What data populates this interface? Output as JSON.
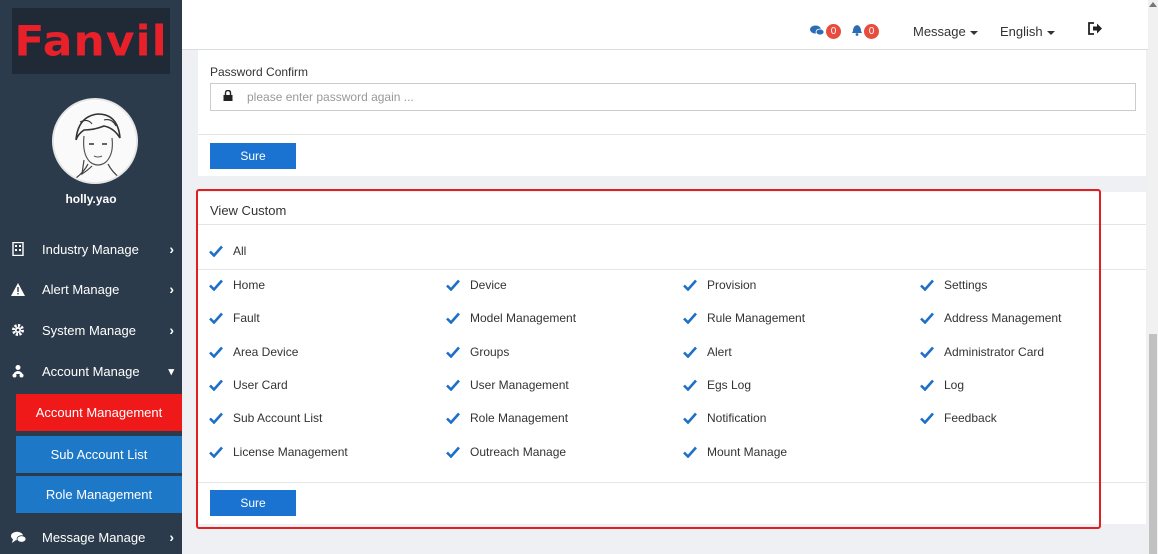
{
  "app": {
    "logo_text": "Fanvil"
  },
  "user": {
    "name": "holly.yao"
  },
  "topbar": {
    "message_count": "0",
    "alert_count": "0",
    "message_label": "Message",
    "language_label": "English"
  },
  "sidebar": {
    "items": [
      {
        "label": "Industry Manage",
        "icon": "building-icon"
      },
      {
        "label": "Alert Manage",
        "icon": "warning-icon"
      },
      {
        "label": "System Manage",
        "icon": "gear-icon"
      },
      {
        "label": "Account Manage",
        "icon": "users-icon"
      },
      {
        "label": "Message Manage",
        "icon": "comments-icon"
      }
    ],
    "sub_items": [
      {
        "label": "Account Management"
      },
      {
        "label": "Sub Account List"
      },
      {
        "label": "Role Management"
      }
    ]
  },
  "password_panel": {
    "label": "Password Confirm",
    "placeholder": "please enter password again ...",
    "value": "",
    "sure_label": "Sure"
  },
  "view_custom": {
    "title": "View Custom",
    "all_label": "All",
    "sure_label": "Sure",
    "columns": [
      [
        "Home",
        "Fault",
        "Area Device",
        "User Card",
        "Sub Account List",
        "License Management"
      ],
      [
        "Device",
        "Model Management",
        "Groups",
        "User Management",
        "Role Management",
        "Outreach Manage"
      ],
      [
        "Provision",
        "Rule Management",
        "Alert",
        "Egs Log",
        "Notification",
        "Mount Manage"
      ],
      [
        "Settings",
        "Address Management",
        "Administrator Card",
        "Log",
        "Feedback"
      ]
    ]
  },
  "colors": {
    "sidebar_bg": "#2c3b4b",
    "accent_blue": "#1a73d0",
    "active_red": "#f01919",
    "check_blue": "#1e6fc8"
  }
}
